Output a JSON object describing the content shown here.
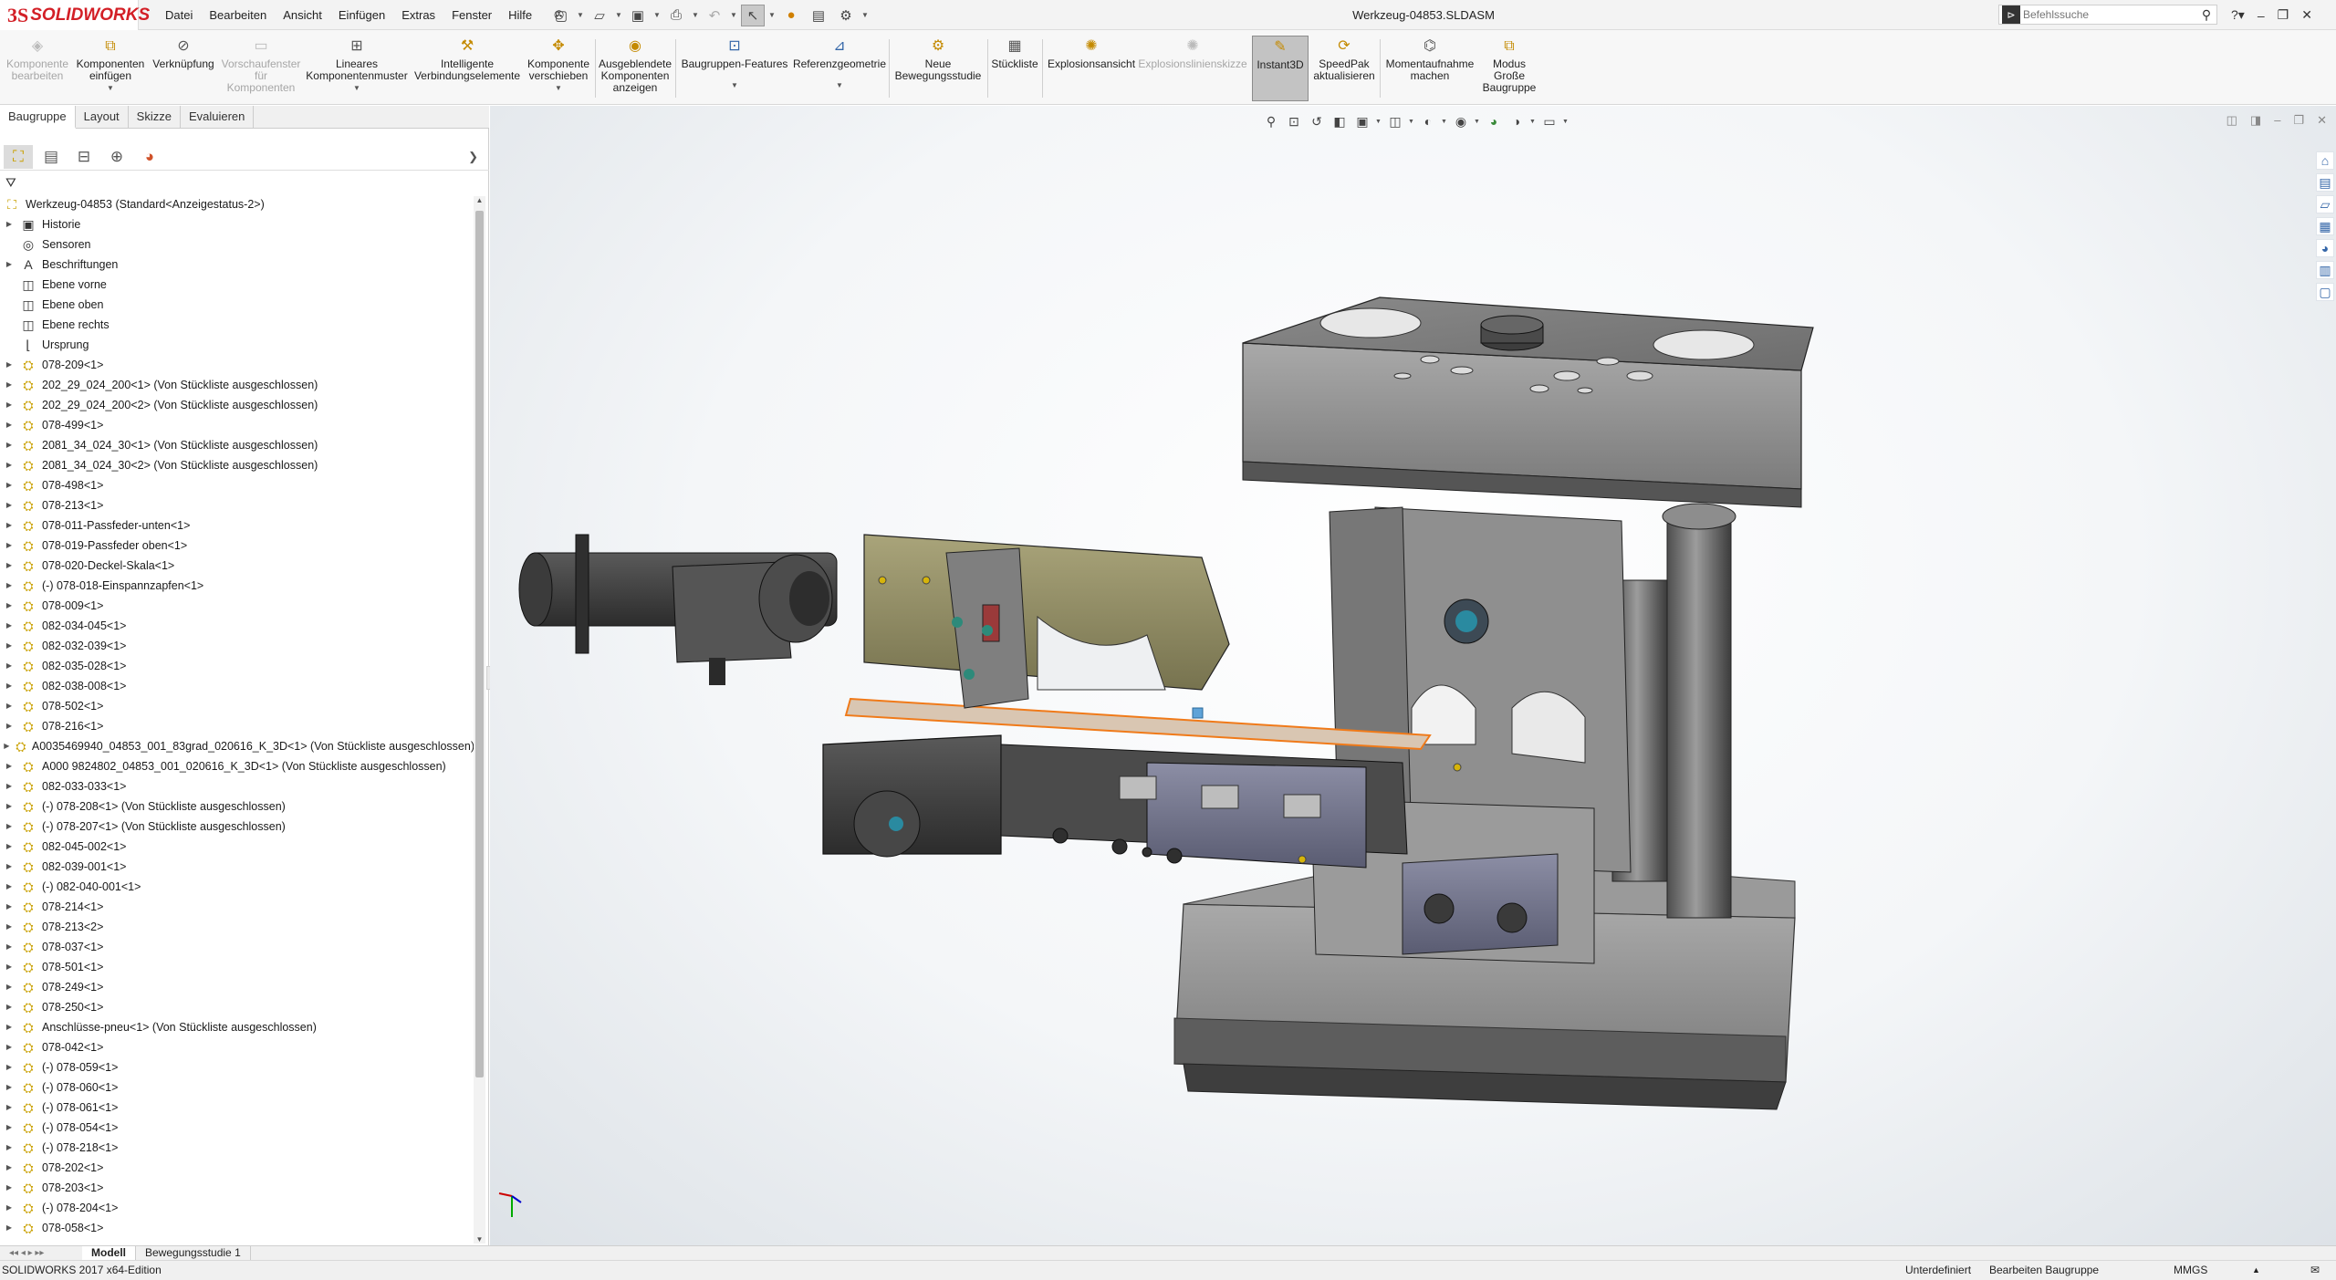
{
  "app": {
    "brand_ds": "3S",
    "brand_name": "SOLIDWORKS",
    "document_title": "Werkzeug-04853.SLDASM"
  },
  "menu": [
    "Datei",
    "Bearbeiten",
    "Ansicht",
    "Einfügen",
    "Extras",
    "Fenster",
    "Hilfe"
  ],
  "search": {
    "placeholder": "Befehlssuche"
  },
  "ribbon": {
    "edit_component": "Komponente bearbeiten",
    "insert_components": "Komponenten einfügen",
    "mate": "Verknüpfung",
    "preview_window": "Vorschaufenster für Komponenten",
    "linear_pattern": "Lineares Komponentenmuster",
    "smart_fasteners": "Intelligente Verbindungselemente",
    "move_component": "Komponente verschieben",
    "show_hidden": "Ausgeblendete Komponenten anzeigen",
    "assembly_features": "Baugruppen-Features",
    "reference_geometry": "Referenzgeometrie",
    "new_motion_study": "Neue Bewegungsstudie",
    "bom": "Stückliste",
    "exploded_view": "Explosionsansicht",
    "explode_line_sketch": "Explosionslinienskizze",
    "instant3d": "Instant3D",
    "speedpak": "SpeedPak aktualisieren",
    "snapshot": "Momentaufnahme machen",
    "large_assembly": "Modus Große Baugruppe"
  },
  "tabs": [
    "Baugruppe",
    "Layout",
    "Skizze",
    "Evaluieren"
  ],
  "tree": {
    "root": "Werkzeug-04853  (Standard<Anzeigestatus-2>)",
    "items": [
      "Historie",
      "Sensoren",
      "Beschriftungen",
      "Ebene vorne",
      "Ebene oben",
      "Ebene rechts",
      "Ursprung",
      "078-209<1>",
      "202_29_024_200<1> (Von Stückliste ausgeschlossen)",
      "202_29_024_200<2> (Von Stückliste ausgeschlossen)",
      "078-499<1>",
      "2081_34_024_30<1> (Von Stückliste ausgeschlossen)",
      "2081_34_024_30<2> (Von Stückliste ausgeschlossen)",
      "078-498<1>",
      "078-213<1>",
      "078-011-Passfeder-unten<1>",
      "078-019-Passfeder oben<1>",
      "078-020-Deckel-Skala<1>",
      "(-) 078-018-Einspannzapfen<1>",
      "078-009<1>",
      "082-034-045<1>",
      "082-032-039<1>",
      "082-035-028<1>",
      "082-038-008<1>",
      "078-502<1>",
      "078-216<1>",
      "A0035469940_04853_001_83grad_020616_K_3D<1> (Von Stückliste ausgeschlossen)",
      "A000 9824802_04853_001_020616_K_3D<1> (Von Stückliste ausgeschlossen)",
      "082-033-033<1>",
      "(-) 078-208<1> (Von Stückliste ausgeschlossen)",
      "(-) 078-207<1> (Von Stückliste ausgeschlossen)",
      "082-045-002<1>",
      "082-039-001<1>",
      "(-) 082-040-001<1>",
      "078-214<1>",
      "078-213<2>",
      "078-037<1>",
      "078-501<1>",
      "078-249<1>",
      "078-250<1>",
      "Anschlüsse-pneu<1> (Von Stückliste ausgeschlossen)",
      "078-042<1>",
      "(-) 078-059<1>",
      "(-) 078-060<1>",
      "(-) 078-061<1>",
      "(-) 078-054<1>",
      "(-) 078-218<1>",
      "078-202<1>",
      "078-203<1>",
      "(-) 078-204<1>",
      "078-058<1>"
    ]
  },
  "bottom_tabs": [
    "Modell",
    "Bewegungsstudie 1"
  ],
  "status": {
    "edition": "SOLIDWORKS 2017 x64-Edition",
    "state": "Unterdefiniert",
    "mode": "Bearbeiten Baugruppe",
    "units": "MMGS"
  }
}
